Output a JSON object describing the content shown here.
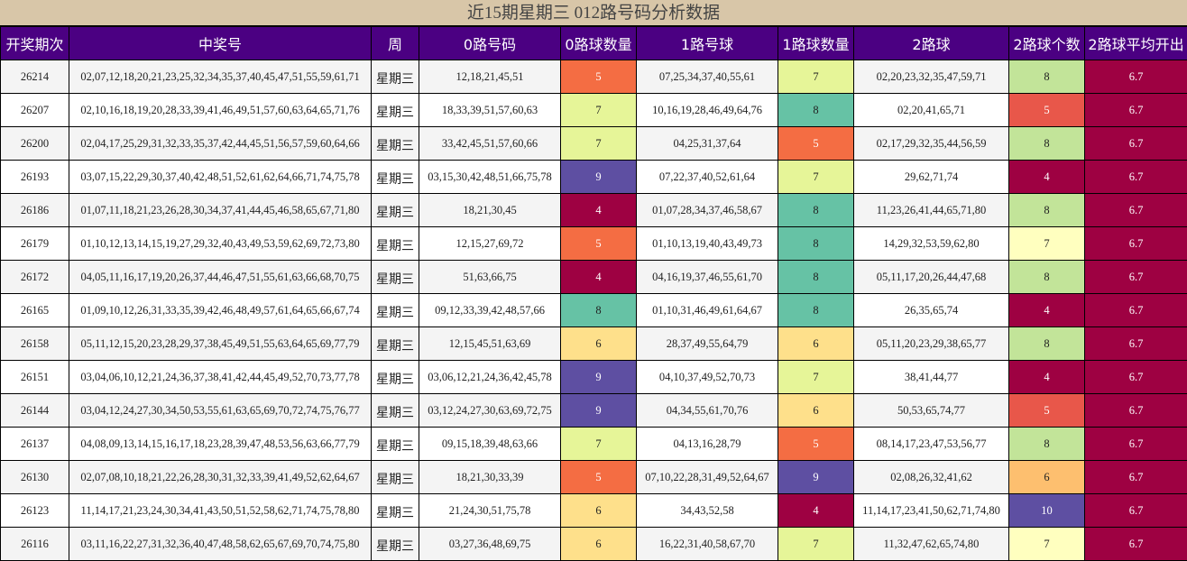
{
  "title": "近15期星期三 012路号码分析数据",
  "headers": [
    "开奖期次",
    "中奖号",
    "周",
    "0路号码",
    "0路球数量",
    "1路号球",
    "1路球数量",
    "2路球",
    "2路球个数",
    "2路球平均开出"
  ],
  "colors": {
    "4": "#9e0142",
    "5": "#f46d43",
    "6": "#fee08b",
    "7": "#e6f598",
    "8": "#66c2a5",
    "9": "#5e4fa2",
    "10": "#5e4fa2",
    "2_4": "#9e0142",
    "2_5": "#e8574a",
    "2_6": "#fdbf6f",
    "2_7": "#ffffbf",
    "2_8": "#c2e499",
    "avg": "#9e0142"
  },
  "rows": [
    {
      "period": "26214",
      "numbers": "02,07,12,18,20,21,23,25,32,34,35,37,40,45,47,51,55,59,61,71",
      "week": "星期三",
      "r0": "12,18,21,45,51",
      "c0": "5",
      "r1": "07,25,34,37,40,55,61",
      "c1": "7",
      "r2": "02,20,23,32,35,47,59,71",
      "c2": "8",
      "avg": "6.7"
    },
    {
      "period": "26207",
      "numbers": "02,10,16,18,19,20,28,33,39,41,46,49,51,57,60,63,64,65,71,76",
      "week": "星期三",
      "r0": "18,33,39,51,57,60,63",
      "c0": "7",
      "r1": "10,16,19,28,46,49,64,76",
      "c1": "8",
      "r2": "02,20,41,65,71",
      "c2": "5",
      "avg": "6.7"
    },
    {
      "period": "26200",
      "numbers": "02,04,17,25,29,31,32,33,35,37,42,44,45,51,56,57,59,60,64,66",
      "week": "星期三",
      "r0": "33,42,45,51,57,60,66",
      "c0": "7",
      "r1": "04,25,31,37,64",
      "c1": "5",
      "r2": "02,17,29,32,35,44,56,59",
      "c2": "8",
      "avg": "6.7"
    },
    {
      "period": "26193",
      "numbers": "03,07,15,22,29,30,37,40,42,48,51,52,61,62,64,66,71,74,75,78",
      "week": "星期三",
      "r0": "03,15,30,42,48,51,66,75,78",
      "c0": "9",
      "r1": "07,22,37,40,52,61,64",
      "c1": "7",
      "r2": "29,62,71,74",
      "c2": "4",
      "avg": "6.7"
    },
    {
      "period": "26186",
      "numbers": "01,07,11,18,21,23,26,28,30,34,37,41,44,45,46,58,65,67,71,80",
      "week": "星期三",
      "r0": "18,21,30,45",
      "c0": "4",
      "r1": "01,07,28,34,37,46,58,67",
      "c1": "8",
      "r2": "11,23,26,41,44,65,71,80",
      "c2": "8",
      "avg": "6.7"
    },
    {
      "period": "26179",
      "numbers": "01,10,12,13,14,15,19,27,29,32,40,43,49,53,59,62,69,72,73,80",
      "week": "星期三",
      "r0": "12,15,27,69,72",
      "c0": "5",
      "r1": "01,10,13,19,40,43,49,73",
      "c1": "8",
      "r2": "14,29,32,53,59,62,80",
      "c2": "7",
      "avg": "6.7"
    },
    {
      "period": "26172",
      "numbers": "04,05,11,16,17,19,20,26,37,44,46,47,51,55,61,63,66,68,70,75",
      "week": "星期三",
      "r0": "51,63,66,75",
      "c0": "4",
      "r1": "04,16,19,37,46,55,61,70",
      "c1": "8",
      "r2": "05,11,17,20,26,44,47,68",
      "c2": "8",
      "avg": "6.7"
    },
    {
      "period": "26165",
      "numbers": "01,09,10,12,26,31,33,35,39,42,46,48,49,57,61,64,65,66,67,74",
      "week": "星期三",
      "r0": "09,12,33,39,42,48,57,66",
      "c0": "8",
      "r1": "01,10,31,46,49,61,64,67",
      "c1": "8",
      "r2": "26,35,65,74",
      "c2": "4",
      "avg": "6.7"
    },
    {
      "period": "26158",
      "numbers": "05,11,12,15,20,23,28,29,37,38,45,49,51,55,63,64,65,69,77,79",
      "week": "星期三",
      "r0": "12,15,45,51,63,69",
      "c0": "6",
      "r1": "28,37,49,55,64,79",
      "c1": "6",
      "r2": "05,11,20,23,29,38,65,77",
      "c2": "8",
      "avg": "6.7"
    },
    {
      "period": "26151",
      "numbers": "03,04,06,10,12,21,24,36,37,38,41,42,44,45,49,52,70,73,77,78",
      "week": "星期三",
      "r0": "03,06,12,21,24,36,42,45,78",
      "c0": "9",
      "r1": "04,10,37,49,52,70,73",
      "c1": "7",
      "r2": "38,41,44,77",
      "c2": "4",
      "avg": "6.7"
    },
    {
      "period": "26144",
      "numbers": "03,04,12,24,27,30,34,50,53,55,61,63,65,69,70,72,74,75,76,77",
      "week": "星期三",
      "r0": "03,12,24,27,30,63,69,72,75",
      "c0": "9",
      "r1": "04,34,55,61,70,76",
      "c1": "6",
      "r2": "50,53,65,74,77",
      "c2": "5",
      "avg": "6.7"
    },
    {
      "period": "26137",
      "numbers": "04,08,09,13,14,15,16,17,18,23,28,39,47,48,53,56,63,66,77,79",
      "week": "星期三",
      "r0": "09,15,18,39,48,63,66",
      "c0": "7",
      "r1": "04,13,16,28,79",
      "c1": "5",
      "r2": "08,14,17,23,47,53,56,77",
      "c2": "8",
      "avg": "6.7"
    },
    {
      "period": "26130",
      "numbers": "02,07,08,10,18,21,22,26,28,30,31,32,33,39,41,49,52,62,64,67",
      "week": "星期三",
      "r0": "18,21,30,33,39",
      "c0": "5",
      "r1": "07,10,22,28,31,49,52,64,67",
      "c1": "9",
      "r2": "02,08,26,32,41,62",
      "c2": "6",
      "avg": "6.7"
    },
    {
      "period": "26123",
      "numbers": "11,14,17,21,23,24,30,34,41,43,50,51,52,58,62,71,74,75,78,80",
      "week": "星期三",
      "r0": "21,24,30,51,75,78",
      "c0": "6",
      "r1": "34,43,52,58",
      "c1": "4",
      "r2": "11,14,17,23,41,50,62,71,74,80",
      "c2": "10",
      "avg": "6.7"
    },
    {
      "period": "26116",
      "numbers": "03,11,16,22,27,31,32,36,40,47,48,58,62,65,67,69,70,74,75,80",
      "week": "星期三",
      "r0": "03,27,36,48,69,75",
      "c0": "6",
      "r1": "16,22,31,40,58,67,70",
      "c1": "7",
      "r2": "11,32,47,62,65,74,80",
      "c2": "7",
      "avg": "6.7"
    }
  ]
}
